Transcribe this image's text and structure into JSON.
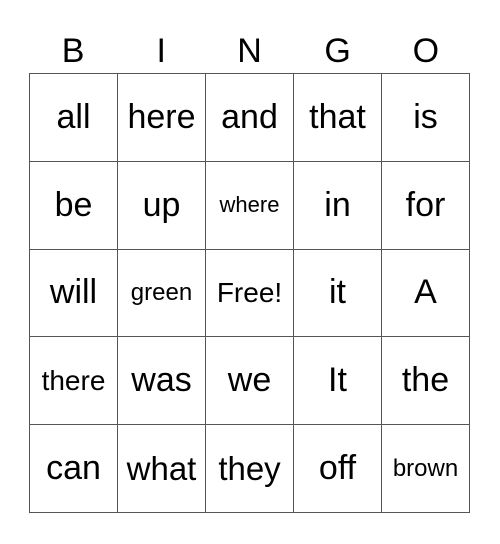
{
  "card": {
    "header": [
      "B",
      "I",
      "N",
      "G",
      "O"
    ],
    "rows": [
      [
        "all",
        "here",
        "and",
        "that",
        "is"
      ],
      [
        "be",
        "up",
        "where",
        "in",
        "for"
      ],
      [
        "will",
        "green",
        "Free!",
        "it",
        "A"
      ],
      [
        "there",
        "was",
        "we",
        "It",
        "the"
      ],
      [
        "can",
        "what",
        "they",
        "off",
        "brown"
      ]
    ],
    "free_space": {
      "row": 3,
      "col": 3,
      "label": "Free!"
    }
  }
}
